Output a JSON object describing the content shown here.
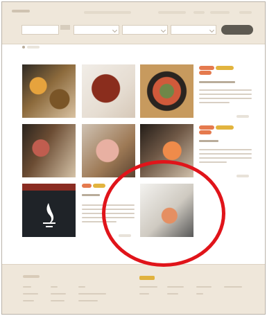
{
  "header": {
    "logo_label": "",
    "search_fields": [
      "",
      "",
      "",
      ""
    ],
    "search_button_label": ""
  },
  "breadcrumb": "",
  "tiles": [
    {
      "name": "food-tile-1"
    },
    {
      "name": "food-tile-2"
    },
    {
      "name": "food-tile-3"
    },
    {
      "name": "food-tile-4"
    },
    {
      "name": "food-tile-5"
    },
    {
      "name": "food-tile-6"
    },
    {
      "name": "food-tile-7"
    },
    {
      "name": "food-tile-8"
    }
  ],
  "info_cards": [
    {
      "tag_colors": [
        "#e57a4e",
        "#e2b43e"
      ],
      "more_link": ""
    },
    {
      "tag_colors": [
        "#e57a4e",
        "#e2b43e"
      ],
      "more_link": ""
    },
    {
      "tag_colors": [
        "#e57a4e",
        "#e2b43e"
      ],
      "more_link": ""
    }
  ],
  "footer": {
    "badge_color": "#e0b23e"
  },
  "colors": {
    "header_bg": "#efe7da",
    "footer_bg": "#efe7da",
    "accent_orange": "#e57a4e",
    "accent_yellow": "#e2b43e",
    "annotation_red": "#e0141a",
    "search_button": "#5e5a52"
  }
}
